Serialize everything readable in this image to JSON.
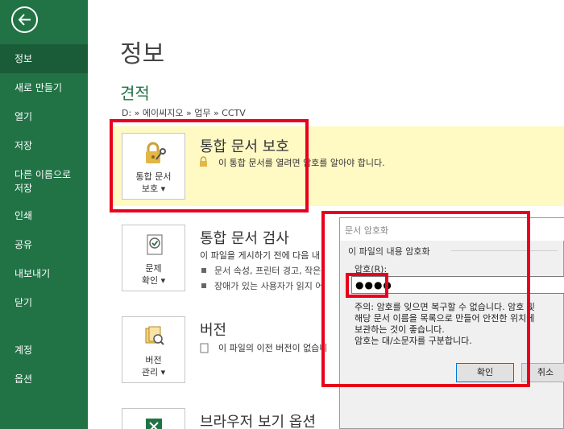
{
  "sidebar": {
    "back_label": "back",
    "items": [
      {
        "label": "정보"
      },
      {
        "label": "새로 만들기"
      },
      {
        "label": "열기"
      },
      {
        "label": "저장"
      },
      {
        "label": "다른 이름으로\n저장"
      },
      {
        "label": "인쇄"
      },
      {
        "label": "공유"
      },
      {
        "label": "내보내기"
      },
      {
        "label": "닫기"
      },
      {
        "label": "계정"
      },
      {
        "label": "옵션"
      }
    ]
  },
  "main": {
    "title": "정보",
    "doc_title": "견적",
    "breadcrumb": "D: » 에이씨지오 » 업무 » CCTV",
    "protect": {
      "button_line1": "통합 문서",
      "button_line2": "보호 ▾",
      "heading": "통합 문서 보호",
      "desc": "이 통합 문서를 열려면 암호를 알아야 합니다."
    },
    "inspect": {
      "button_line1": "문제",
      "button_line2": "확인 ▾",
      "heading": "통합 문서 검사",
      "desc": "이 파일을 게시하기 전에 다음 내",
      "bullets": [
        "문서 속성, 프린터 경고, 작은",
        "장애가 있는 사용자가 읽지 어"
      ]
    },
    "versions": {
      "button_line1": "버전",
      "button_line2": "관리 ▾",
      "heading": "버전",
      "desc": "이 파일의 이전 버전이 없습니"
    },
    "browser": {
      "heading": "브라우저 보기 옵션"
    }
  },
  "dialog": {
    "title": "문서 암호화",
    "group_label": "이 파일의 내용 암호화",
    "password_label": "암호(R):",
    "password_value": "●●●●",
    "note": "주의: 암호를 잊으면 복구할 수 없습니다. 암호 및\n해당 문서 이름을 목록으로 만들어 안전한 위치에\n보관하는 것이 좋습니다.\n암호는 대/소문자를 구분합니다.",
    "ok_label": "확인",
    "cancel_label": "취소"
  },
  "colors": {
    "sidebar": "#217346",
    "accent_green": "#217346",
    "protect_panel": "#fff9c4",
    "highlight_red": "#e8001c"
  }
}
